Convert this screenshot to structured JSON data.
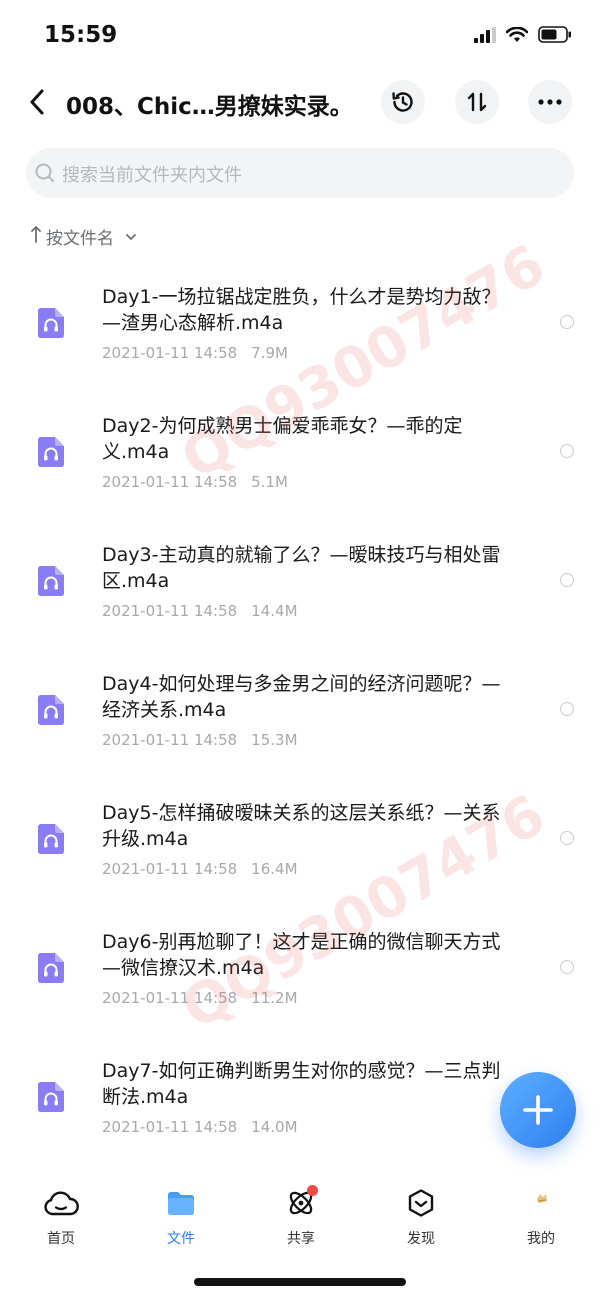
{
  "status": {
    "time": "15:59"
  },
  "nav": {
    "title": "008、Chic…男撩妹实录。"
  },
  "search": {
    "placeholder": "搜索当前文件夹内文件"
  },
  "sort": {
    "label": "按文件名"
  },
  "files": [
    {
      "name": "Day1-一场拉锯战定胜负，什么才是势均力敌？—渣男心态解析.m4a",
      "date": "2021-01-11 14:58",
      "size": "7.9M"
    },
    {
      "name": "Day2-为何成熟男士偏爱乖乖女？—乖的定义.m4a",
      "date": "2021-01-11 14:58",
      "size": "5.1M"
    },
    {
      "name": "Day3-主动真的就输了么？—暧昧技巧与相处雷区.m4a",
      "date": "2021-01-11 14:58",
      "size": "14.4M"
    },
    {
      "name": "Day4-如何处理与多金男之间的经济问题呢？—经济关系.m4a",
      "date": "2021-01-11 14:58",
      "size": "15.3M"
    },
    {
      "name": "Day5-怎样捅破暧昧关系的这层关系纸？—关系升级.m4a",
      "date": "2021-01-11 14:58",
      "size": "16.4M"
    },
    {
      "name": "Day6-别再尬聊了！这才是正确的微信聊天方式—微信撩汉术.m4a",
      "date": "2021-01-11 14:58",
      "size": "11.2M"
    },
    {
      "name": "Day7-如何正确判断男生对你的感觉？—三点判断法.m4a",
      "date": "2021-01-11 14:58",
      "size": "14.0M"
    }
  ],
  "watermark": {
    "text": "QQ93007476"
  },
  "tabs": [
    {
      "label": "首页",
      "icon": "cloud-icon"
    },
    {
      "label": "文件",
      "icon": "folder-icon"
    },
    {
      "label": "共享",
      "icon": "atom-icon"
    },
    {
      "label": "发现",
      "icon": "compass-icon"
    },
    {
      "label": "我的",
      "icon": "profile-icon"
    }
  ],
  "colors": {
    "accent": "#2f7ef0",
    "file_icon": "#8a7cf5",
    "badge": "#f24848"
  }
}
